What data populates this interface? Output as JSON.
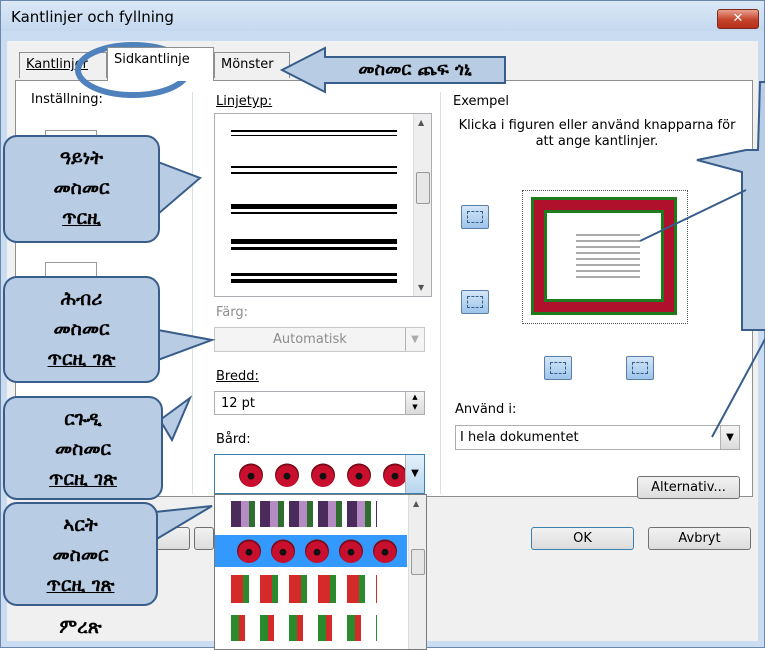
{
  "window": {
    "title": "Kantlinjer och fyllning",
    "close_glyph": "✕"
  },
  "tabs": [
    {
      "label": "Kantlinjer",
      "active": false
    },
    {
      "label": "Sidkantlinje",
      "active": true
    },
    {
      "label": "Mönster",
      "active": false
    }
  ],
  "setting": {
    "label": "Inställning:"
  },
  "linetype": {
    "label": "Linjetyp:"
  },
  "color": {
    "label": "Färg:",
    "value": "Automatisk"
  },
  "width": {
    "label": "Bredd:",
    "value": "12 pt"
  },
  "art": {
    "label": "Bård:"
  },
  "example": {
    "label": "Exempel",
    "hint": "Klicka i figuren eller använd knapparna för att ange kantlinjer."
  },
  "apply": {
    "label": "Använd i:",
    "value": "I hela dokumentet"
  },
  "buttons": {
    "options": "Alternativ...",
    "ok": "OK",
    "cancel": "Avbryt"
  },
  "annotations": {
    "tab_arrow": "መስመር ጨፍ ጎኒ",
    "style": [
      "ዓይነት",
      "መስመር",
      "ጥርዚ"
    ],
    "color": [
      "ሕብሪ",
      "መስመር",
      "ጥርዚ ገጽ"
    ],
    "width": [
      "ርጉዲ",
      "መስመር",
      "ጥርዚ ገጽ"
    ],
    "art": [
      "ኣርት",
      "መስመር",
      "ጥርዚ ገጽ",
      "ምረጽ"
    ]
  },
  "colors": {
    "callout_fill": "#b8cce4",
    "callout_border": "#385d8a",
    "highlight_oval": "#4f81bd",
    "selection": "#3399ff"
  }
}
